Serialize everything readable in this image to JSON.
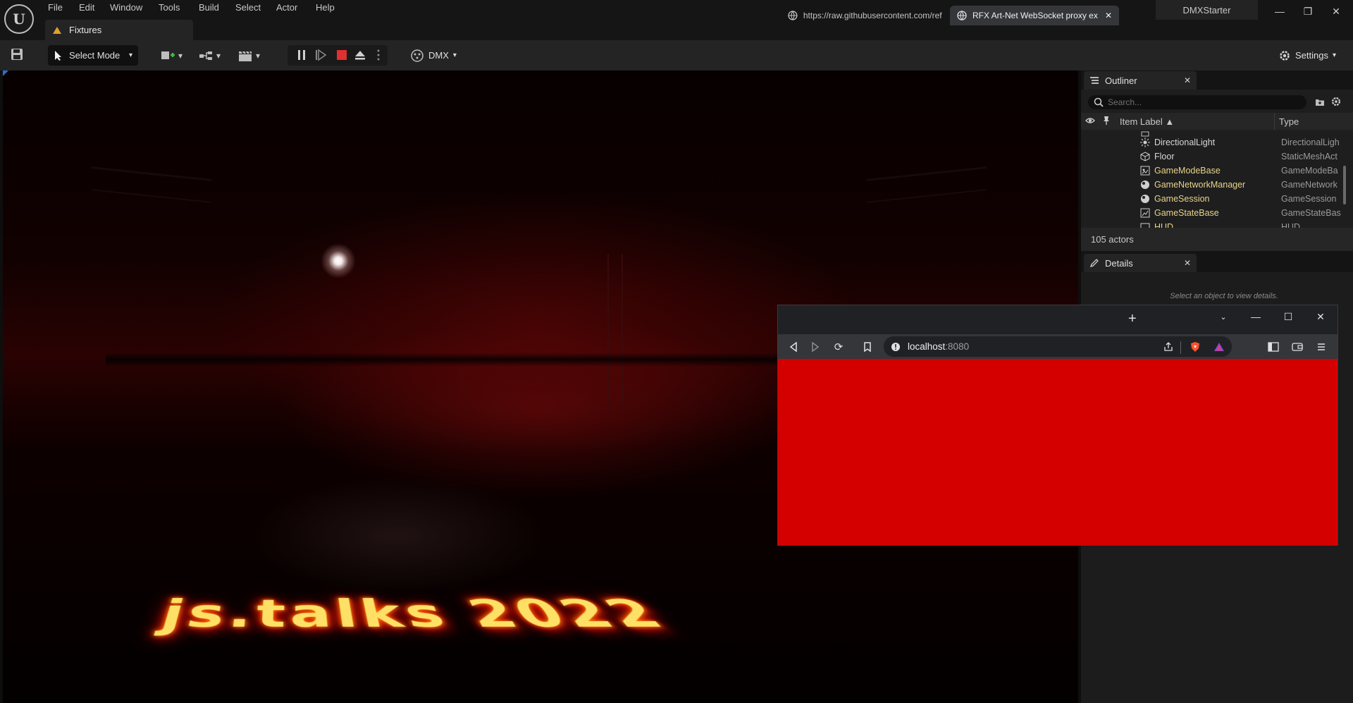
{
  "menu": {
    "items": [
      "File",
      "Edit",
      "Window",
      "Tools",
      "Build",
      "Select",
      "Actor",
      "Help"
    ]
  },
  "document_tab": {
    "label": "Fixtures"
  },
  "project": {
    "name": "DMXStarter"
  },
  "toolbar": {
    "select_mode_label": "Select Mode",
    "dmx_label": "DMX",
    "settings_label": "Settings"
  },
  "viewport": {
    "overlay_text": "js.talks 2022"
  },
  "outliner": {
    "title": "Outliner",
    "search_placeholder": "Search...",
    "columns": {
      "label": "Item Label ▲",
      "type": "Type"
    },
    "rows": [
      {
        "name": "DirectionalLight",
        "type": "DirectionalLigh",
        "icon": "directional-light-icon"
      },
      {
        "name": "Floor",
        "type": "StaticMeshAct",
        "icon": "static-mesh-icon"
      },
      {
        "name": "GameModeBase",
        "type": "GameModeBa",
        "icon": "game-mode-icon"
      },
      {
        "name": "GameNetworkManager",
        "type": "GameNetwork",
        "icon": "network-manager-icon"
      },
      {
        "name": "GameSession",
        "type": "GameSession",
        "icon": "game-session-icon"
      },
      {
        "name": "GameStateBase",
        "type": "GameStateBas",
        "icon": "game-state-icon"
      },
      {
        "name": "HUD",
        "type": "HUD",
        "icon": "hud-icon"
      }
    ],
    "actor_count": "105 actors"
  },
  "details": {
    "title": "Details",
    "hint": "Select an object to view details."
  },
  "browser": {
    "tabs": [
      {
        "title": "https://raw.githubusercontent.com/ref",
        "active": false
      },
      {
        "title": "RFX Art-Net WebSocket proxy ex",
        "active": true
      }
    ],
    "url_host": "localhost",
    "url_port": ":8080",
    "content_color": "#d40000"
  },
  "colors": {
    "accent_blue": "#2a6dd6",
    "stop_red": "#e03030",
    "text_glow": "#ffe066"
  }
}
